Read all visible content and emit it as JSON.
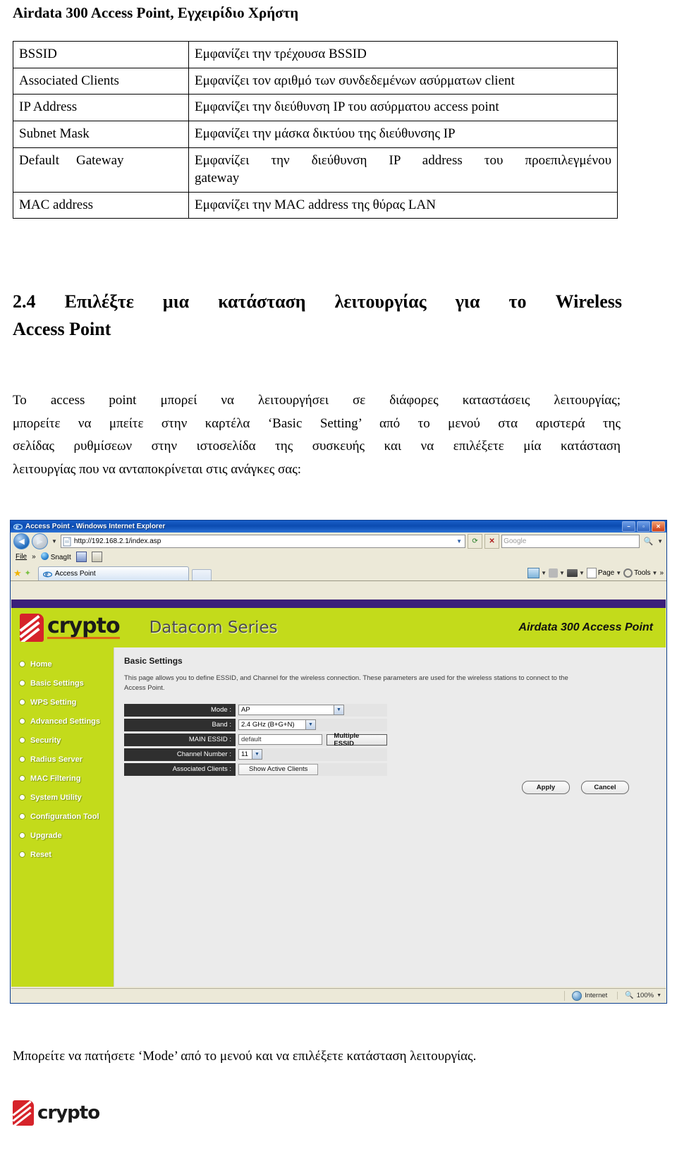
{
  "document": {
    "title": "Airdata 300 Access Point, Εγχειρίδιο Χρήστη",
    "spec_table": {
      "rows": [
        {
          "key": "BSSID",
          "value": "Εμφανίζει την τρέχουσα BSSID"
        },
        {
          "key": "Associated Clients",
          "value": "Εμφανίζει τον αριθμό των συνδεδεμένων ασύρματων client"
        },
        {
          "key": "IP Address",
          "value": "Εμφανίζει την διεύθυνση IP του ασύρματου access point"
        },
        {
          "key": "Subnet Mask",
          "value": "Εμφανίζει την μάσκα δικτύου της διεύθυνσης IP"
        },
        {
          "key": "Default",
          "key2": "Gateway",
          "value": "Εμφανίζει την διεύθυνση IP address του προεπιλεγμένου",
          "value2": "gateway"
        },
        {
          "key": "MAC address",
          "value": "Εμφανίζει την MAC address της θύρας LAN"
        }
      ]
    },
    "section": {
      "heading_line1": "2.4 Επιλέξτε μια κατάσταση λειτουργίας για το Wireless",
      "heading_line2": "Access Point",
      "paragraph_lines": [
        "Το access point μπορεί να λειτουργήσει σε διάφορες καταστάσεις λειτουργίας;",
        "μπορείτε να μπείτε στην καρτέλα ‘Basic Setting’ από το μενού στα αριστερά της",
        "σελίδας ρυθμίσεων στην ιστοσελίδα της συσκευής και να επιλέξετε μία   κατάσταση",
        "λειτουργίας που να ανταποκρίνεται στις ανάγκες σας:"
      ]
    },
    "footer_note": "Μπορείτε να πατήσετε ‘Mode’ από το μενού και να επιλέξετε κατάσταση λειτουργίας.",
    "footer_logo_word": "crypto"
  },
  "browser": {
    "window_title": "Access Point - Windows Internet Explorer",
    "icons": {
      "app": "ie-icon",
      "back": "back-arrow-icon",
      "forward": "forward-arrow-icon",
      "history_dropdown": "chevron-down-icon",
      "page": "page-icon",
      "address_dropdown": "chevron-down-icon",
      "refresh": "refresh-icon",
      "stop": "stop-icon",
      "search": "search-icon",
      "search_dropdown": "chevron-down-icon",
      "favorites_star": "star-icon",
      "add_favorites": "add-star-icon",
      "tab": "ie-icon",
      "home": "home-icon",
      "feeds": "rss-icon",
      "print": "printer-icon",
      "page_menu": "page-icon",
      "tools": "gear-icon",
      "overflow": "chevrons-right-icon",
      "zone": "globe-icon",
      "zoom": "magnifier-icon"
    },
    "window_buttons": {
      "minimize": "–",
      "maximize": "▫",
      "close": "✕"
    },
    "address_bar": {
      "url": "http://192.168.2.1/index.asp"
    },
    "search_bar": {
      "placeholder": "Google"
    },
    "menu": {
      "file": "File",
      "overflow": "»",
      "snagit": "SnagIt"
    },
    "tab": {
      "label": "Access Point"
    },
    "command_bar": {
      "page": "Page",
      "tools": "Tools",
      "overflow": "»"
    },
    "status_bar": {
      "left": "",
      "zone": "Internet",
      "zoom": "100%"
    }
  },
  "web_ui": {
    "banner": {
      "logo_word": "crypto",
      "series": "Datacom Series",
      "model": "Airdata 300 Access Point",
      "accent_green": "#c3db1b",
      "accent_purple": "#3b1f7a",
      "accent_red": "#d6232a"
    },
    "sidebar": {
      "items": [
        {
          "label": "Home"
        },
        {
          "label": "Basic Settings"
        },
        {
          "label": "WPS Setting"
        },
        {
          "label": "Advanced Settings"
        },
        {
          "label": "Security"
        },
        {
          "label": "Radius Server"
        },
        {
          "label": "MAC Filtering"
        },
        {
          "label": "System Utility"
        },
        {
          "label": "Configuration Tool"
        },
        {
          "label": "Upgrade"
        },
        {
          "label": "Reset"
        }
      ]
    },
    "main": {
      "heading": "Basic Settings",
      "description": "This page allows you to define ESSID, and Channel for the wireless connection. These parameters are used for the wireless stations to connect to the Access Point.",
      "fields": {
        "mode": {
          "label": "Mode :",
          "value": "AP"
        },
        "band": {
          "label": "Band :",
          "value": "2.4 GHz (B+G+N)"
        },
        "main_essid": {
          "label": "MAIN ESSID :",
          "value": "default",
          "button": "Multiple ESSID"
        },
        "channel_number": {
          "label": "Channel Number :",
          "value": "11"
        },
        "associated_clients": {
          "label": "Associated Clients :",
          "button": "Show Active Clients"
        }
      },
      "actions": {
        "apply": "Apply",
        "cancel": "Cancel"
      }
    }
  }
}
